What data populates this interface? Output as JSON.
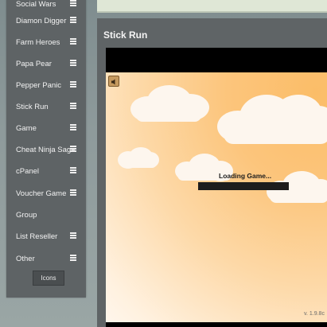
{
  "sidebar": {
    "items": [
      {
        "label": "Social Wars",
        "has_menu": true
      },
      {
        "label": "Diamon Digger",
        "has_menu": true
      },
      {
        "label": "Farm Heroes",
        "has_menu": true
      },
      {
        "label": "Papa Pear",
        "has_menu": true
      },
      {
        "label": "Pepper Panic",
        "has_menu": true
      },
      {
        "label": "Stick Run",
        "has_menu": true
      },
      {
        "label": "Game",
        "has_menu": true
      },
      {
        "label": "Cheat Ninja Saga",
        "has_menu": true
      },
      {
        "label": "cPanel",
        "has_menu": true
      },
      {
        "label": "Voucher Game",
        "has_menu": true
      },
      {
        "label": "Group",
        "has_menu": false
      },
      {
        "label": "List Reseller",
        "has_menu": true
      },
      {
        "label": "Other",
        "has_menu": true
      }
    ],
    "icons_button": "Icons"
  },
  "content": {
    "title": "Stick Run"
  },
  "game": {
    "loading_text": "Loading Game...",
    "version": "v. 1.9.8c",
    "sound_icon": "speaker-icon"
  },
  "colors": {
    "sidebar_bg": "#5e6365",
    "header_bg": "#dfe7d6",
    "sky_orange": "#fbbd68"
  }
}
